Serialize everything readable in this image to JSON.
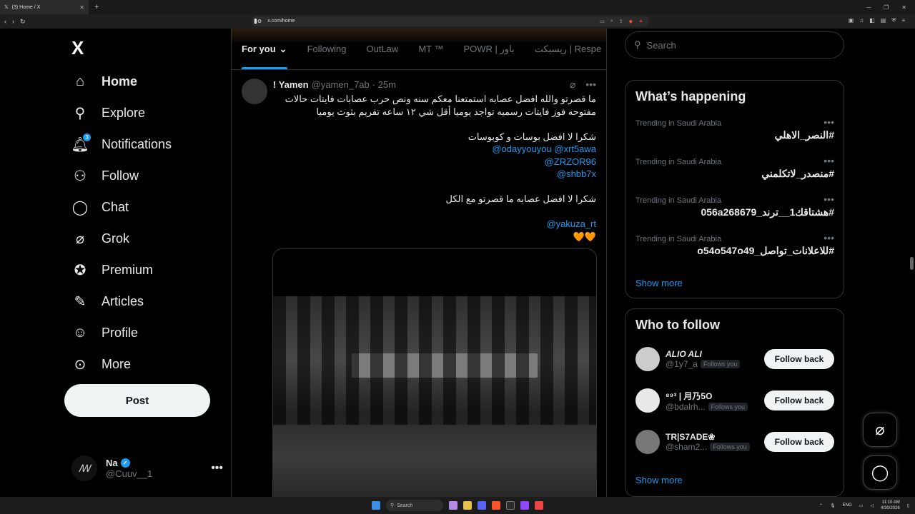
{
  "browser": {
    "tab_title": "(3) Home / X",
    "url": "x.com/home"
  },
  "nav": {
    "logo": "X",
    "items": [
      {
        "label": "Home"
      },
      {
        "label": "Explore"
      },
      {
        "label": "Notifications",
        "badge": "3"
      },
      {
        "label": "Follow"
      },
      {
        "label": "Chat"
      },
      {
        "label": "Grok"
      },
      {
        "label": "Premium"
      },
      {
        "label": "Articles"
      },
      {
        "label": "Profile"
      },
      {
        "label": "More"
      }
    ],
    "post_label": "Post"
  },
  "account": {
    "name": "Na",
    "handle": "@Cuuv__1",
    "avatar_text": "ꟿ"
  },
  "feed": {
    "tabs": [
      "For you",
      "Following",
      "OutLaw",
      "MT ™",
      "POWR | باور",
      "ريسبكت | Respe"
    ],
    "tweet": {
      "name": "! Yamen",
      "handle": "@yamen_7ab",
      "time": "· 25m",
      "line1": "ما قصرتو والله افضل عصابه استمتعنا معكم سنه ونص حرب عصابات فايتات حالات",
      "line2": "مفتوحه فوز فايتات رسميه تواجد يوميا أقل شي ١٢ ساعه تفريم  بثوث يوميا",
      "line3": "شكرا لا افضل بوسات و كوبوسات",
      "mentions1": "@odayyouyou @xrt5awa",
      "mentions2": "@ZRZOR96",
      "mentions3": "@shbb7x",
      "line4": "شكرا لا افضل عصابه ما قصرتو مع الكل",
      "mention4": "@yakuza_rt",
      "hearts": "🧡🧡"
    }
  },
  "search": {
    "placeholder": "Search"
  },
  "happening": {
    "title": "What’s happening",
    "trends": [
      {
        "context": "Trending in Saudi Arabia",
        "tag": "#النصر_الاهلي"
      },
      {
        "context": "Trending in Saudi Arabia",
        "tag": "#منصدر_لاتكلمني"
      },
      {
        "context": "Trending in Saudi Arabia",
        "tag": "#هشتاقك1__ترند_056a268679"
      },
      {
        "context": "Trending in Saudi Arabia",
        "tag": "#للاعلانات_تواصل_o54o547o49"
      }
    ],
    "show_more": "Show more"
  },
  "who_to_follow": {
    "title": "Who to follow",
    "users": [
      {
        "name": "ALIO ALI",
        "handle": "@1y7_a",
        "tag": "Follows you",
        "button": "Follow back"
      },
      {
        "name": "⁸⁹³ | 月乃5O",
        "handle": "@bdalrh...",
        "tag": "Follows you",
        "button": "Follow back"
      },
      {
        "name": "TR|S7ADE❀",
        "handle": "@sham2...",
        "tag": "Follows you",
        "button": "Follow back"
      }
    ],
    "show_more": "Show more"
  },
  "taskbar": {
    "search": "Search",
    "lang": "ENG",
    "time": "11:10 AM",
    "date": "4/30/2026"
  },
  "colors": {
    "accent": "#1d9bf0",
    "background": "#000000",
    "border": "#2f3336"
  }
}
